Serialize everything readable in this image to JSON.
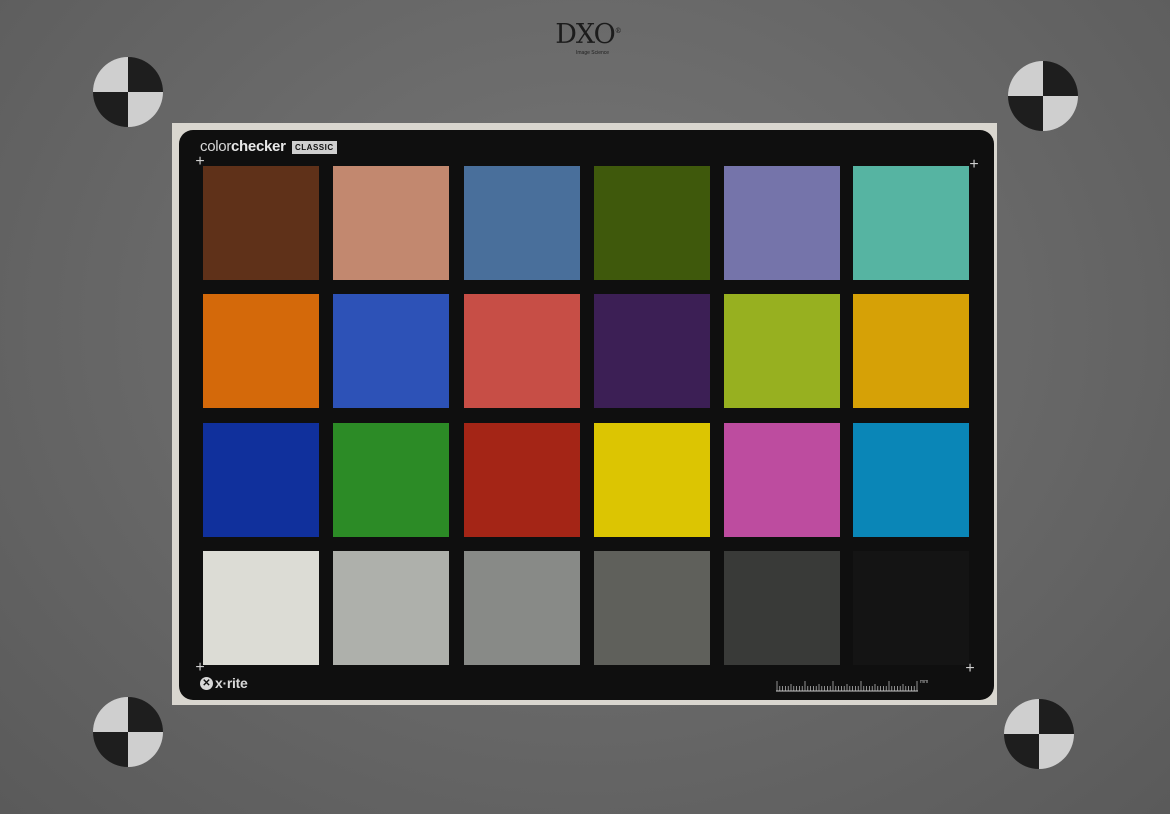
{
  "brand": {
    "logo_text": "DXO",
    "reg_mark": "®",
    "subtitle": "Image Science"
  },
  "registration_targets": [
    "calibration-target",
    "calibration-target",
    "calibration-target",
    "calibration-target"
  ],
  "card": {
    "title_light": "color",
    "title_bold": "checker",
    "badge": "CLASSIC",
    "maker_icon": "x-rite-logo-icon",
    "maker": "x·rite",
    "ruler_unit": "mm",
    "crosshair_glyph": "+"
  },
  "patches": [
    [
      "#5f3119",
      "#c2886f",
      "#496f9b",
      "#3f590c",
      "#7574aa",
      "#56b4a2"
    ],
    [
      "#d4690a",
      "#2d52b7",
      "#c74e46",
      "#3c1f55",
      "#97b020",
      "#d6a106"
    ],
    [
      "#10309c",
      "#2c8b26",
      "#a42516",
      "#dcc502",
      "#bd4c9f",
      "#0a86b7"
    ],
    [
      "#dcdcd5",
      "#aeb0ab",
      "#888a87",
      "#5f605b",
      "#393a38",
      "#141414"
    ]
  ]
}
